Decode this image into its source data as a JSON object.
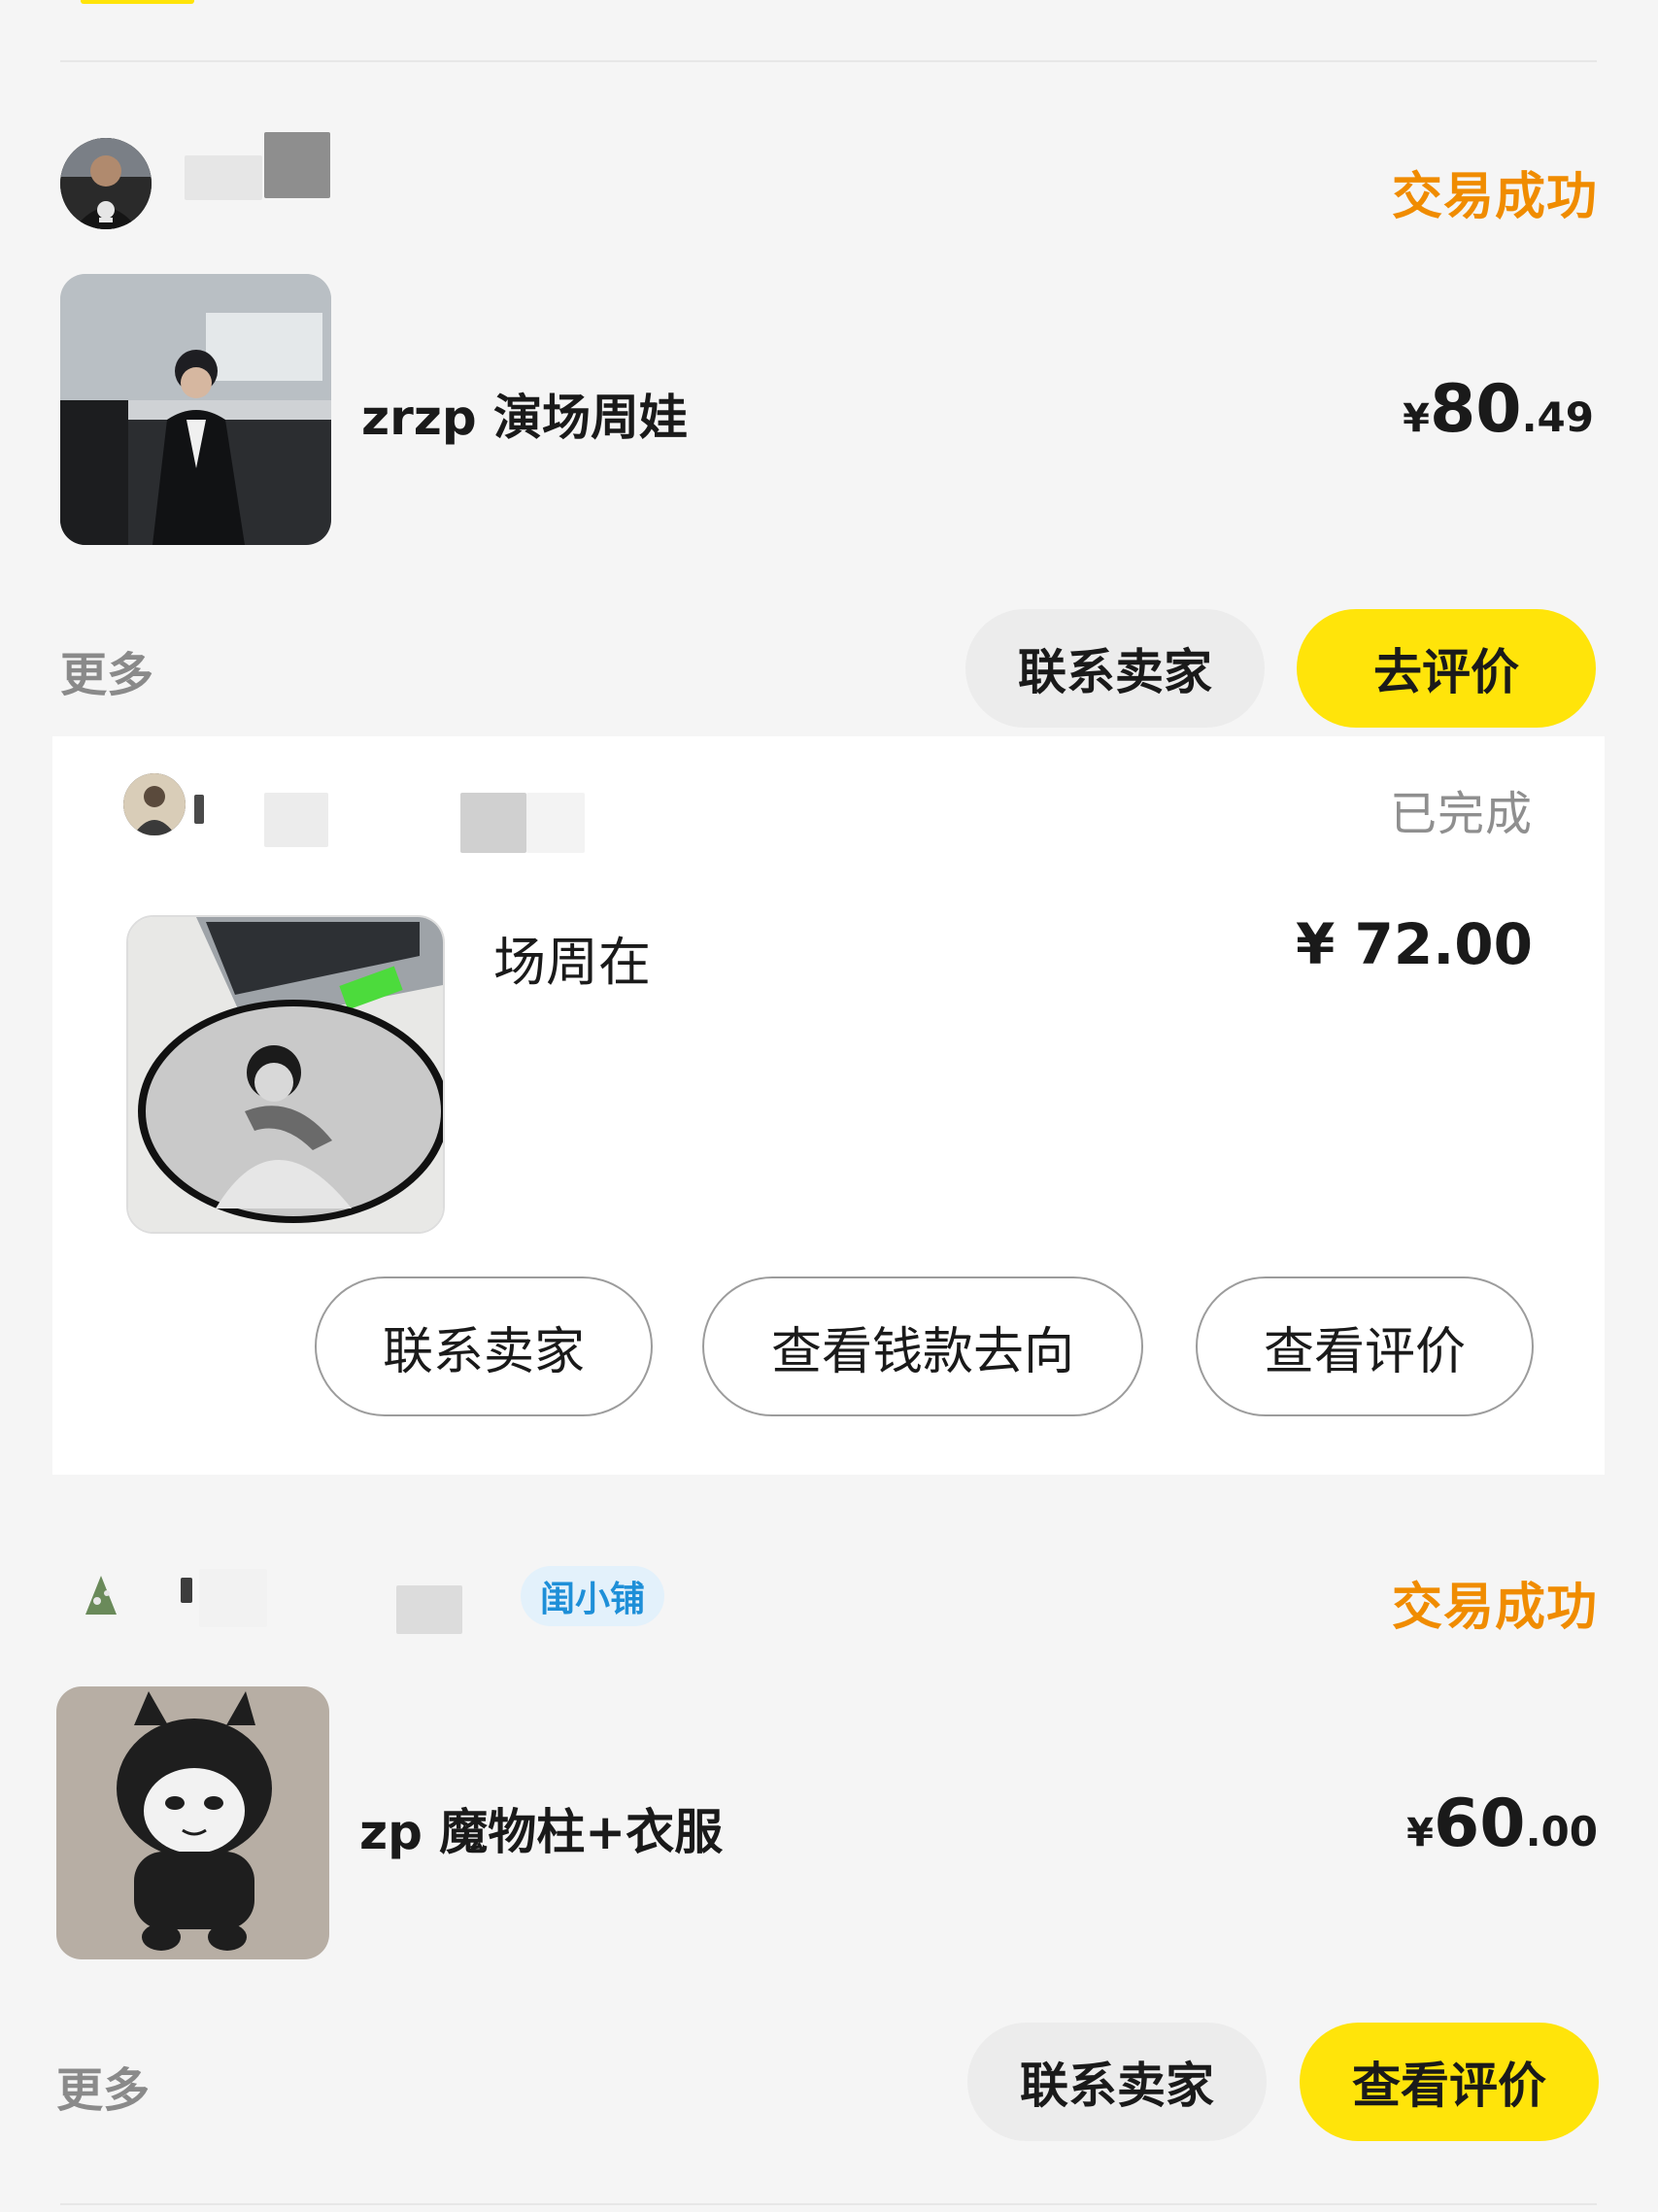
{
  "orders": [
    {
      "status": "交易成功",
      "title": "zrzp 演场周娃",
      "price": {
        "currency": "¥",
        "integer": "80",
        "decimal": ".49"
      },
      "more": "更多",
      "buttons": {
        "contact": "联系卖家",
        "primary": "去评价"
      }
    },
    {
      "status": "已完成",
      "title": "场周在",
      "price_text": "¥ 72.00",
      "buttons": {
        "contact": "联系卖家",
        "money_flow": "查看钱款去向",
        "view_review": "查看评价"
      }
    },
    {
      "status": "交易成功",
      "shop_badge": "闺小铺",
      "title": "zp 魔物柱+衣服",
      "price": {
        "currency": "¥",
        "integer": "60",
        "decimal": ".00"
      },
      "more": "更多",
      "buttons": {
        "contact": "联系卖家",
        "primary": "查看评价"
      }
    }
  ],
  "colors": {
    "accent_yellow": "#ffe40a",
    "status_orange": "#f08c00",
    "badge_blue": "#1e8fd8"
  }
}
